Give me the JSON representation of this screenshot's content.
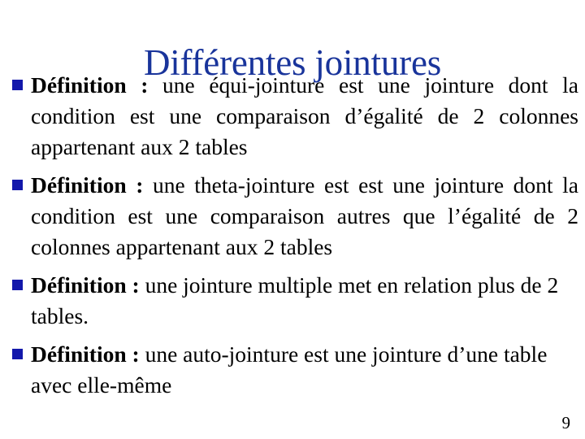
{
  "slide": {
    "title": "Différentes jointures",
    "title_color": "#19349b",
    "bullet_color": "#1318ab",
    "body_color": "#000000",
    "background_color": "#ffffff",
    "page_number": "9"
  },
  "bullets": [
    {
      "marker": "blue-square-bullet",
      "lead": "Définition :",
      "text": " une équi-jointure est une jointure dont la condition est une comparaison d’égalité de 2 colonnes appartenant aux 2 tables"
    },
    {
      "marker": "blue-square-bullet",
      "lead": "Définition :",
      "text": " une theta-jointure est est une jointure dont la condition est une comparaison autres que l’égalité de 2 colonnes appartenant  aux 2 tables"
    },
    {
      "marker": "blue-square-bullet",
      "lead": "Définition :",
      "text": " une jointure multiple met en relation plus de 2 tables."
    },
    {
      "marker": "blue-square-bullet",
      "lead": "Définition :",
      "text": " une auto-jointure est une jointure d’une table avec elle-même"
    }
  ]
}
